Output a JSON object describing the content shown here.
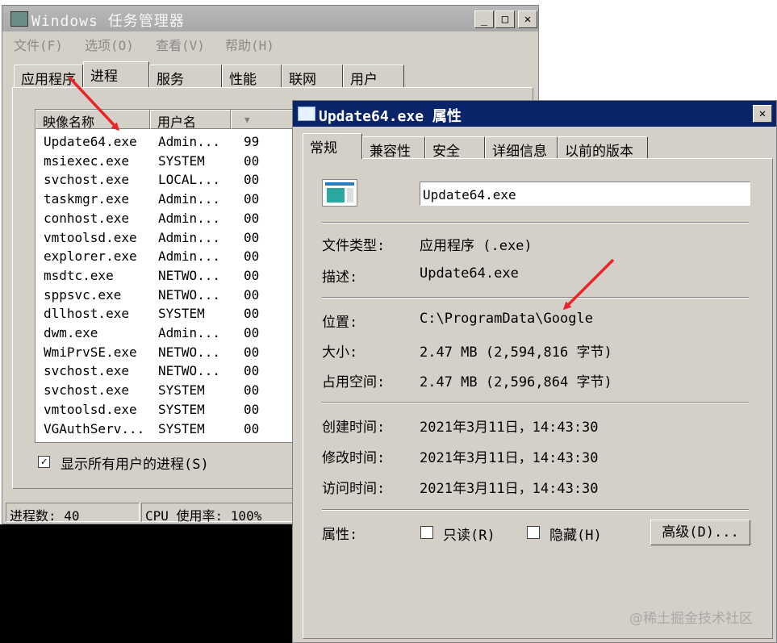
{
  "task_manager": {
    "title": "Windows 任务管理器",
    "menu": [
      "文件(F)",
      "选项(O)",
      "查看(V)",
      "帮助(H)"
    ],
    "tabs": [
      "应用程序",
      "进程",
      "服务",
      "性能",
      "联网",
      "用户"
    ],
    "active_tab": "进程",
    "columns": [
      "映像名称",
      "用户名",
      ""
    ],
    "sort_indicator": "▼",
    "processes": [
      {
        "name": "Update64.exe",
        "user": "Admin...",
        "cpu": "99"
      },
      {
        "name": "msiexec.exe",
        "user": "SYSTEM",
        "cpu": "00"
      },
      {
        "name": "svchost.exe",
        "user": "LOCAL...",
        "cpu": "00"
      },
      {
        "name": "taskmgr.exe",
        "user": "Admin...",
        "cpu": "00"
      },
      {
        "name": "conhost.exe",
        "user": "Admin...",
        "cpu": "00"
      },
      {
        "name": "vmtoolsd.exe",
        "user": "Admin...",
        "cpu": "00"
      },
      {
        "name": "explorer.exe",
        "user": "Admin...",
        "cpu": "00"
      },
      {
        "name": "msdtc.exe",
        "user": "NETWO...",
        "cpu": "00"
      },
      {
        "name": "sppsvc.exe",
        "user": "NETWO...",
        "cpu": "00"
      },
      {
        "name": "dllhost.exe",
        "user": "SYSTEM",
        "cpu": "00"
      },
      {
        "name": "dwm.exe",
        "user": "Admin...",
        "cpu": "00"
      },
      {
        "name": "WmiPrvSE.exe",
        "user": "NETWO...",
        "cpu": "00"
      },
      {
        "name": "svchost.exe",
        "user": "NETWO...",
        "cpu": "00"
      },
      {
        "name": "svchost.exe",
        "user": "SYSTEM",
        "cpu": "00"
      },
      {
        "name": "vmtoolsd.exe",
        "user": "SYSTEM",
        "cpu": "00"
      },
      {
        "name": "VGAuthServ...",
        "user": "SYSTEM",
        "cpu": "00"
      }
    ],
    "show_all_label": "显示所有用户的进程(S)",
    "show_all_checked": "✓",
    "status": {
      "processes": "进程数: 40",
      "cpu": "CPU 使用率: 100%"
    }
  },
  "properties": {
    "title": "Update64.exe 属性",
    "tabs": [
      "常规",
      "兼容性",
      "安全",
      "详细信息",
      "以前的版本"
    ],
    "active_tab": "常规",
    "file_name": "Update64.exe",
    "fields": {
      "type_label": "文件类型:",
      "type_value": "应用程序 (.exe)",
      "desc_label": "描述:",
      "desc_value": "Update64.exe",
      "location_label": "位置:",
      "location_value": "C:\\ProgramData\\Google",
      "size_label": "大小:",
      "size_value": "2.47 MB (2,594,816 字节)",
      "disk_label": "占用空间:",
      "disk_value": "2.47 MB (2,596,864 字节)",
      "created_label": "创建时间:",
      "created_value": "2021年3月11日，14:43:30",
      "modified_label": "修改时间:",
      "modified_value": "2021年3月11日，14:43:30",
      "accessed_label": "访问时间:",
      "accessed_value": "2021年3月11日，14:43:30",
      "attr_label": "属性:"
    },
    "readonly_label": "只读(R)",
    "hidden_label": "隐藏(H)",
    "advanced_label": "高级(D)..."
  },
  "watermark": "@稀土掘金技术社区",
  "colors": {
    "annotation_arrow": "#e8262a",
    "dialog_title": "#0a246a",
    "window_face": "#d4d0c8"
  }
}
